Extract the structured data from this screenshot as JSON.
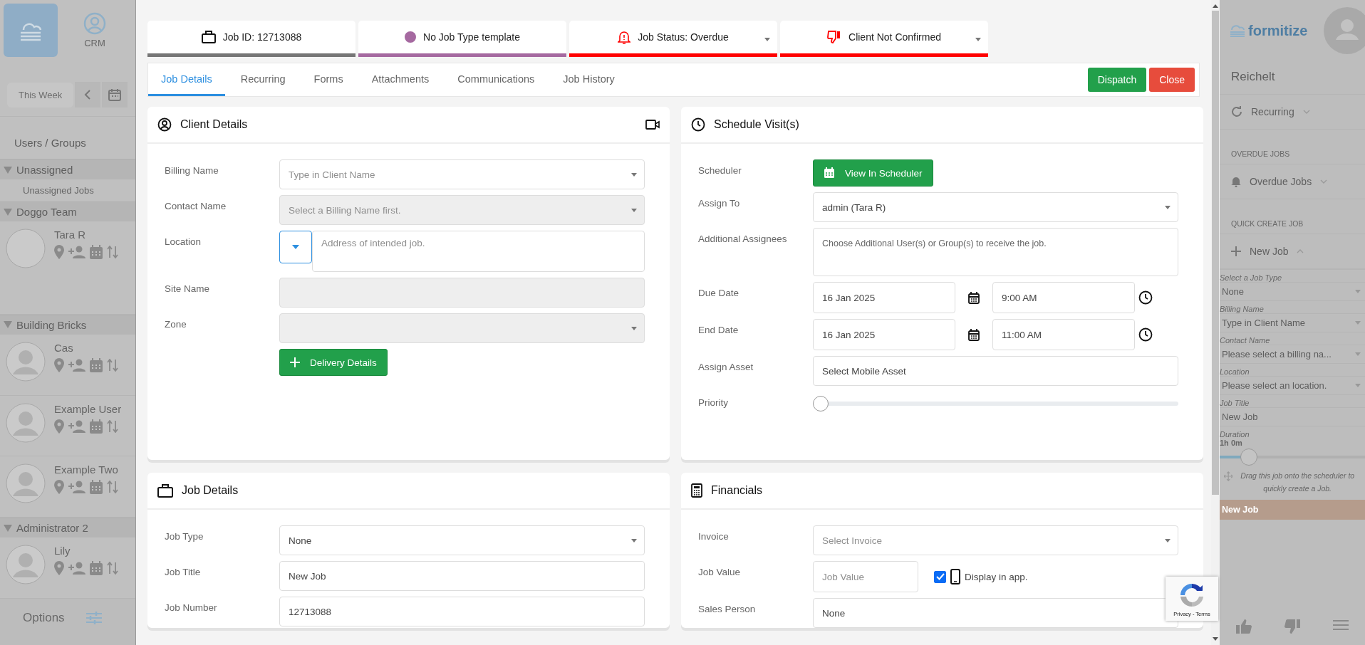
{
  "backdrop_left": {
    "nav_tiles": [
      {
        "kind": "home",
        "selected": true
      },
      {
        "kind": "crm",
        "label": "CRM",
        "selected": false
      }
    ],
    "period": "This Week",
    "heading": "Users / Groups",
    "groups": [
      {
        "name": "Unassigned",
        "expanded": true,
        "members": [
          {
            "kind": "link",
            "name": "Unassigned Jobs"
          }
        ]
      },
      {
        "name": "Doggo Team",
        "expanded": true,
        "members": [
          {
            "kind": "user-empty",
            "name": "Tara R"
          }
        ]
      },
      {
        "name": "Building Bricks",
        "expanded": true,
        "members": [
          {
            "kind": "user",
            "name": "Cas"
          },
          {
            "kind": "user",
            "name": "Example User"
          },
          {
            "kind": "user",
            "name": "Example Two"
          }
        ]
      },
      {
        "name": "Administrator 2",
        "expanded": true,
        "members": [
          {
            "kind": "user",
            "name": "Lily"
          }
        ]
      }
    ],
    "options": "Options"
  },
  "job_modal": {
    "chips": [
      {
        "kind": "job-id",
        "text": "Job ID: 12713088",
        "color": "#767676",
        "dropdown": false
      },
      {
        "kind": "job-type",
        "text": "No Job Type template",
        "color": "#a569a0",
        "dropdown": false
      },
      {
        "kind": "status",
        "text": "Job Status: Overdue",
        "color": "#ff0000",
        "dropdown": true
      },
      {
        "kind": "client",
        "text": "Client Not Confirmed",
        "color": "#ff0000",
        "dropdown": true
      }
    ],
    "tabs": [
      {
        "label": "Job Details",
        "selected": true
      },
      {
        "label": "Recurring",
        "selected": false
      },
      {
        "label": "Forms",
        "selected": false
      },
      {
        "label": "Attachments",
        "selected": false
      },
      {
        "label": "Communications",
        "selected": false
      },
      {
        "label": "Job History",
        "selected": false
      }
    ],
    "buttons": [
      {
        "kind": "dispatch",
        "label": "Dispatch"
      },
      {
        "kind": "close",
        "label": "Close"
      }
    ],
    "cards": [
      {
        "kind": "client",
        "title": "Client Details",
        "fields": [
          {
            "kind": "select",
            "label": "Billing Name",
            "placeholder": "Type in Client Name",
            "disabled": false
          },
          {
            "kind": "select",
            "label": "Contact Name",
            "placeholder": "Select a Billing Name first.",
            "disabled": true
          },
          {
            "kind": "location",
            "label": "Location",
            "placeholder": "Address of intended job.",
            "disabled": false
          },
          {
            "kind": "text",
            "label": "Site Name",
            "disabled": true
          },
          {
            "kind": "select",
            "label": "Zone",
            "disabled": true
          },
          {
            "kind": "add-button",
            "value": "Delivery Details"
          }
        ]
      },
      {
        "kind": "schedule",
        "title": "Schedule Visit(s)",
        "fields": [
          {
            "kind": "button",
            "label": "Scheduler",
            "value": "View In Scheduler"
          },
          {
            "kind": "select",
            "label": "Assign To",
            "value": "admin (Tara R)",
            "disabled": false
          },
          {
            "kind": "textarea",
            "label": "Additional Assignees",
            "placeholder": "Choose Additional User(s) or Group(s) to receive the job."
          },
          {
            "kind": "datetime",
            "label": "Due Date",
            "date": "16 Jan 2025",
            "time": "9:00 AM"
          },
          {
            "kind": "datetime",
            "label": "End Date",
            "date": "16 Jan 2025",
            "time": "11:00 AM"
          },
          {
            "kind": "text",
            "label": "Assign Asset",
            "value": "Select Mobile Asset",
            "disabled": false
          },
          {
            "kind": "slider",
            "label": "Priority",
            "level": 0
          }
        ]
      },
      {
        "kind": "job",
        "title": "Job Details",
        "fields": [
          {
            "kind": "select",
            "label": "Job Type",
            "value": "None",
            "disabled": false
          },
          {
            "kind": "text",
            "label": "Job Title",
            "value": "New Job",
            "disabled": false
          },
          {
            "kind": "text",
            "label": "Job Number",
            "value": "12713088",
            "disabled": false
          }
        ]
      },
      {
        "kind": "financials",
        "title": "Financials",
        "fields": [
          {
            "kind": "select",
            "label": "Invoice",
            "placeholder": "Select Invoice",
            "disabled": false
          },
          {
            "kind": "value-check",
            "label": "Job Value",
            "placeholder": "Job Value",
            "checked": true,
            "check_label": "Display in app."
          },
          {
            "kind": "text",
            "label": "Sales Person",
            "value": "None",
            "disabled": false
          }
        ]
      }
    ]
  },
  "backdrop_right": {
    "logo": "formitize",
    "title": "Reichelt",
    "sections": [
      {
        "items": [
          {
            "label": "Recurring",
            "expanded": false
          }
        ]
      },
      {
        "heading": "OVERDUE JOBS",
        "items": [
          {
            "label": "Overdue Jobs",
            "expanded": false
          }
        ]
      },
      {
        "heading": "QUICK CREATE JOB",
        "items": [
          {
            "label": "New Job",
            "expanded": true
          }
        ]
      }
    ],
    "quick_form": [
      {
        "kind": "select",
        "label": "Select a Job Type",
        "value": "None"
      },
      {
        "kind": "select",
        "label": "Billing Name",
        "value": "Type in Client Name"
      },
      {
        "kind": "select",
        "label": "Contact Name",
        "value": "Please select a billing na..."
      },
      {
        "kind": "select",
        "label": "Location",
        "value": "Please select an location."
      },
      {
        "kind": "text",
        "label": "Job Title",
        "value": "New Job"
      },
      {
        "kind": "slider",
        "label": "Duration",
        "value": "1h 0m",
        "level": 0.2
      }
    ],
    "drag_hint": "Drag this job onto the scheduler to quickly create a Job.",
    "banner": "New Job"
  },
  "recaptcha": {
    "links": "Privacy - Terms"
  }
}
